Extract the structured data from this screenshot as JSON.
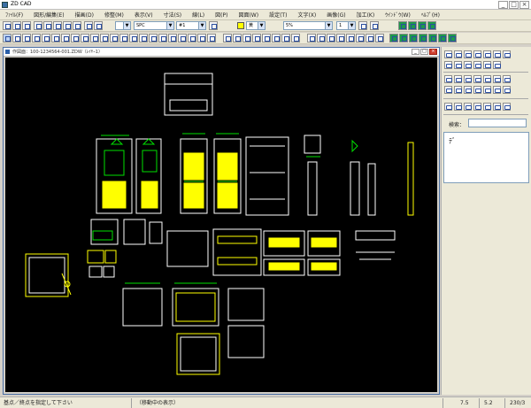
{
  "app": {
    "title": "ZD CAD",
    "close_glyph": "×",
    "min_glyph": "_",
    "max_glyph": "□"
  },
  "menu": [
    "ﾌｧｲﾙ(F)",
    "図形/編集(E)",
    "描画(D)",
    "修整(M)",
    "表示(V)",
    "寸法(S)",
    "線(L)",
    "図(P)",
    "図面(W)",
    "設定(T)",
    "文字(X)",
    "画像(G)",
    "加工(K)",
    "ｳｲﾝﾄﾞｳ(W)",
    "ﾍﾙﾌﾟ(H)"
  ],
  "toolbar2": {
    "linetype": "SPC",
    "pen": "#1",
    "layer": "1",
    "color_label": "黄",
    "scale": "5%"
  },
  "document": {
    "title": "作図面：100-1234564-001.ZDW（ﾚｲﾔｰ1）"
  },
  "right_panel": {
    "search_label": "検索：",
    "list_value": "ﾃﾞ"
  },
  "status": {
    "message": "基点／終点を指定して下さい",
    "mode": "（移動中の表示）",
    "x": "7.5",
    "y": "5.2",
    "count": "230/3"
  },
  "colors": {
    "canvas": "#000000",
    "drawing_white": "#ffffff",
    "drawing_yellow": "#ffff00",
    "drawing_green": "#00e000",
    "accent": "#3a6ea5"
  }
}
